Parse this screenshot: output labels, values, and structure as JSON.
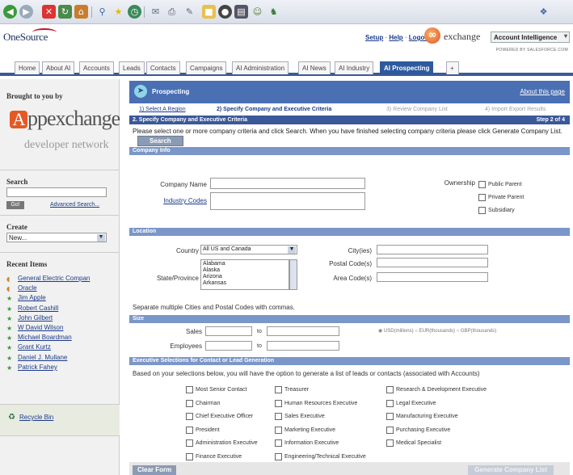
{
  "browser": {
    "icons": [
      "back-icon",
      "forward-icon",
      "stop-icon",
      "refresh-icon",
      "home-icon",
      "search-icon",
      "favorites-icon",
      "media-icon",
      "history-icon",
      "mail-icon",
      "print-icon",
      "edit-icon",
      "folder-icon",
      "discuss-icon",
      "messenger-icon",
      "research-icon",
      "people-icon"
    ]
  },
  "header": {
    "logo": "OneSource",
    "links": {
      "setup": "Setup",
      "help": "Help",
      "logout": "Logout"
    },
    "exchange_text": "exchange",
    "app_selector": "Account Intelligence",
    "powered_by": "POWERED BY SALESFORCE.COM"
  },
  "tabs": [
    "Home",
    "About AI",
    "Accounts",
    "Leads",
    "Contacts",
    "Campaigns",
    "AI Administration",
    "AI News",
    "AI Industry",
    "AI Prospecting",
    "+"
  ],
  "sidebar": {
    "brought_by": "Brought to you by",
    "appexchange_a": "A",
    "appexchange_rest": "ppexchange",
    "developer_network": "developer network",
    "search_title": "Search",
    "go_button": "Go!",
    "advanced_search": "Advanced Search...",
    "create_title": "Create",
    "create_value": "New...",
    "recent_title": "Recent Items",
    "recent_items": [
      {
        "label": "General Electric Compan",
        "icon": "account-icon"
      },
      {
        "label": "Oracle",
        "icon": "account-icon"
      },
      {
        "label": "Jim Apple",
        "icon": "contact-icon"
      },
      {
        "label": "Robert Cashill",
        "icon": "contact-icon"
      },
      {
        "label": "John Gilbert",
        "icon": "contact-icon"
      },
      {
        "label": "W David Wilson",
        "icon": "contact-icon"
      },
      {
        "label": "Michael Boardman",
        "icon": "contact-icon"
      },
      {
        "label": "Grant Kurtz",
        "icon": "contact-icon"
      },
      {
        "label": "Daniel J. Mullane",
        "icon": "contact-icon"
      },
      {
        "label": "Patrick Fahey",
        "icon": "contact-icon"
      }
    ],
    "recycle_bin": "Recycle Bin"
  },
  "main": {
    "title": "Prospecting",
    "about_link": "About this page",
    "steps": [
      "1) Select A Region",
      "2) Specify Company and Executive Criteria",
      "3) Review Company List",
      "4) Import Export Results"
    ],
    "step_bar": "2. Specify Company and Executive Criteria",
    "step_of": "Step 2 of 4",
    "intro": "Please select one or more company criteria and click Search. When you have finished selecting company criteria please click Generate Company List.",
    "search_button": "Search",
    "company_info": {
      "section": "Company Info",
      "company_name_label": "Company Name",
      "industry_codes_label": "Industry Codes",
      "ownership_label": "Ownership",
      "ownership_options": [
        "Public Parent",
        "Private Parent",
        "Subsidiary"
      ]
    },
    "location": {
      "section": "Location",
      "country_label": "Country",
      "country_value": "All US and Canada",
      "state_label": "State/Province",
      "states": [
        "Alabama",
        "Alaska",
        "Arizona",
        "Arkansas"
      ],
      "city_label": "City(ies)",
      "postal_label": "Postal Code(s)",
      "area_label": "Area Code(s)",
      "note": "Separate multiple Cities and Postal Codes with commas."
    },
    "size": {
      "section": "Size",
      "sales_label": "Sales",
      "employees_label": "Employees",
      "to_label": "to",
      "currencies": [
        "USD(millions)",
        "EUR(thousands)",
        "GBP(thousands)"
      ]
    },
    "executive": {
      "section": "Executive Selections for Contact or Lead Generation",
      "description": "Based on your selections below, you will have the option to generate a list of leads or contacts (associated with Accounts)",
      "col1": [
        "Most Senior Contact",
        "Chairman",
        "Chief Executive Officer",
        "President",
        "Administration Executive",
        "Finance Executive"
      ],
      "col2": [
        "Treasurer",
        "Human Resources Executive",
        "Sales Executive",
        "Marketing Executive",
        "Information Executive",
        "Engineering/Technical Executive"
      ],
      "col3": [
        "Research & Development Executive",
        "Legal Executive",
        "Manufacturing Executive",
        "Purchasing Executive",
        "Medical Specialist"
      ]
    },
    "clear_button": "Clear Form",
    "generate_button": "Generate Company List"
  }
}
